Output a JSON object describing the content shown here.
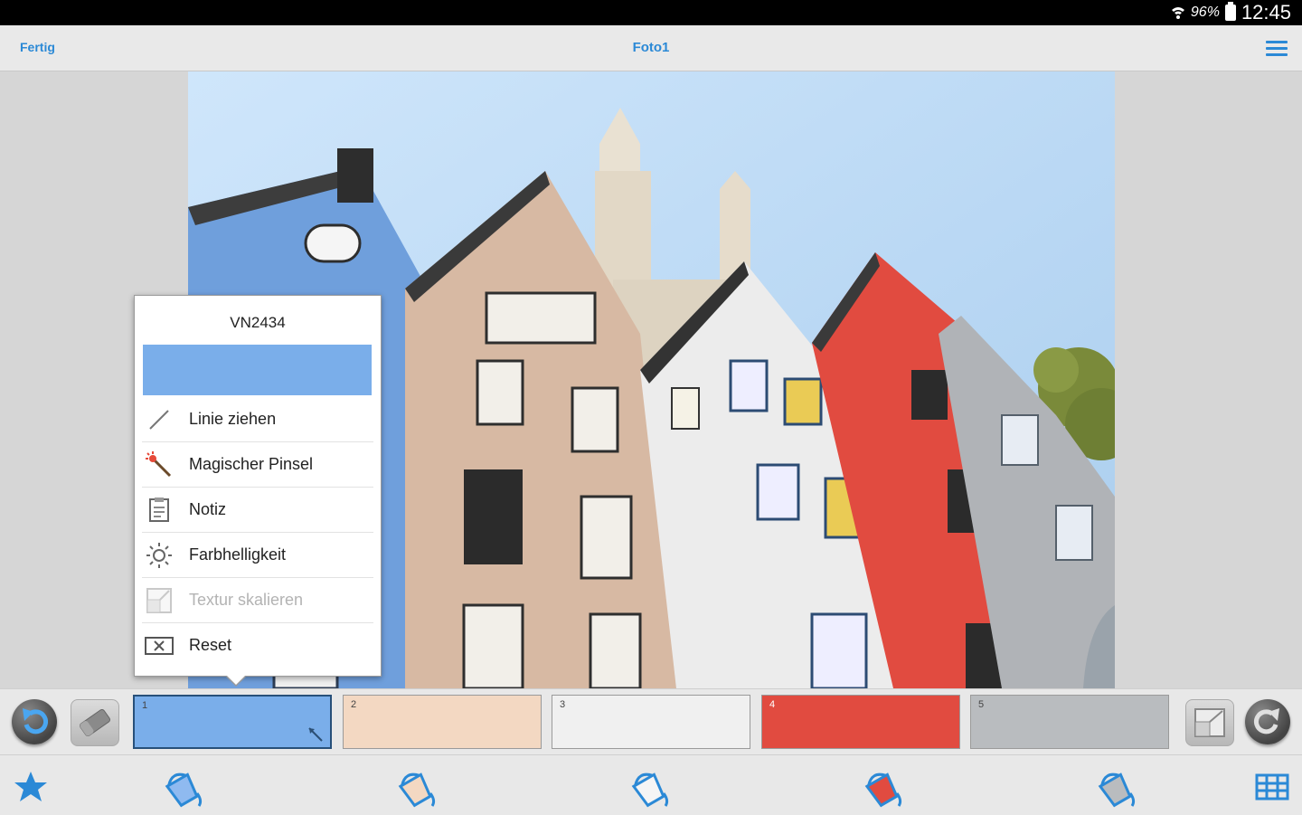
{
  "status": {
    "battery": "96%",
    "time": "12:45"
  },
  "actionbar": {
    "left_label": "Fertig",
    "title": "Foto1",
    "menu_icon": "hamburger-menu-icon"
  },
  "popup": {
    "color_code": "VN2434",
    "swatch_color": "#7aaeea",
    "items": [
      {
        "label": "Linie ziehen",
        "icon": "line-draw-icon",
        "enabled": true
      },
      {
        "label": "Magischer Pinsel",
        "icon": "magic-wand-icon",
        "enabled": true
      },
      {
        "label": "Notiz",
        "icon": "note-icon",
        "enabled": true
      },
      {
        "label": "Farbhelligkeit",
        "icon": "brightness-icon",
        "enabled": true
      },
      {
        "label": "Textur skalieren",
        "icon": "texture-scale-icon",
        "enabled": false
      },
      {
        "label": "Reset",
        "icon": "reset-icon",
        "enabled": true
      }
    ]
  },
  "swatches": [
    {
      "number": "1",
      "color": "#7aaeea",
      "selected": true
    },
    {
      "number": "2",
      "color": "#f3d8c2",
      "selected": false
    },
    {
      "number": "3",
      "color": "#f0f0f0",
      "selected": false
    },
    {
      "number": "4",
      "color": "#e14b40",
      "selected": false
    },
    {
      "number": "5",
      "color": "#b9bcbf",
      "selected": false
    }
  ],
  "colors": {
    "accent": "#2b89d6"
  }
}
